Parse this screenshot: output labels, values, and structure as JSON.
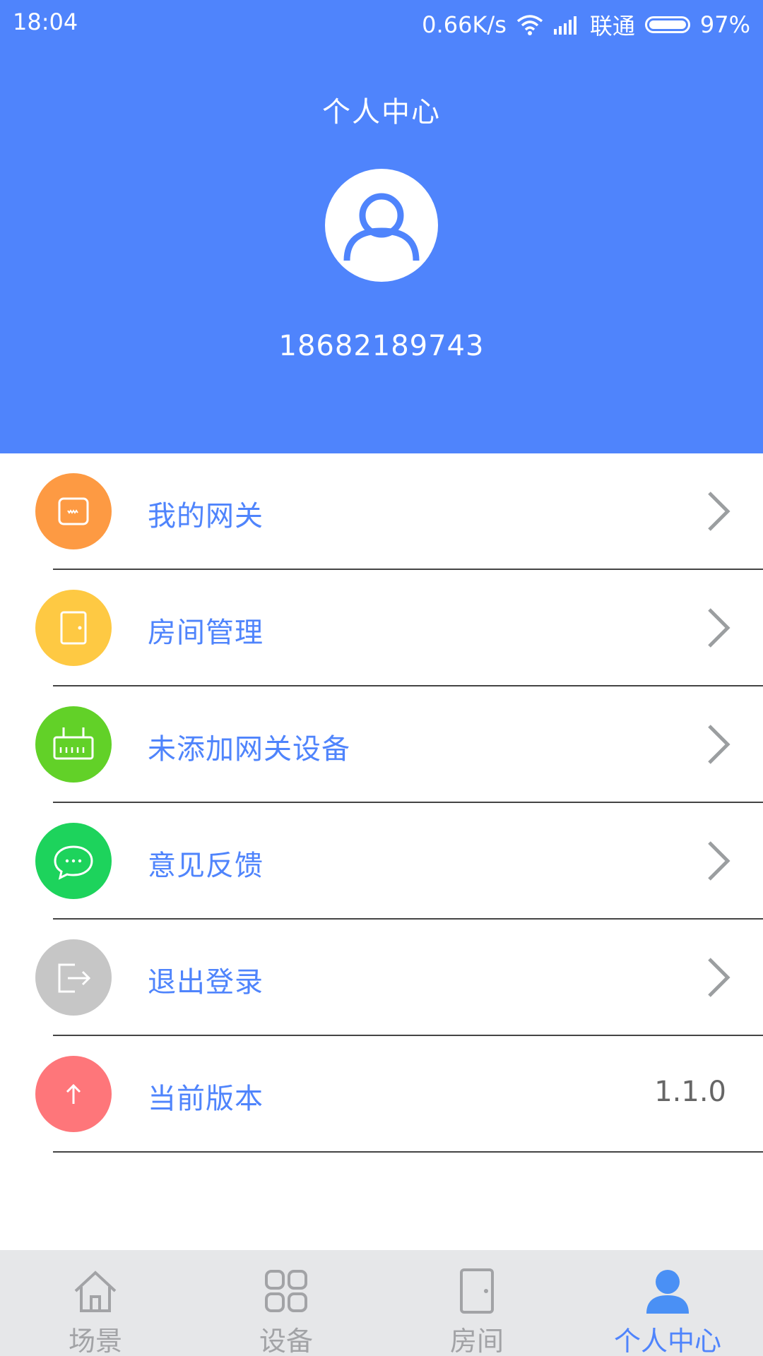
{
  "status_bar": {
    "time": "18:04",
    "network_speed": "0.66K/s",
    "carrier": "联通",
    "battery": "97%"
  },
  "header": {
    "title": "个人中心",
    "phone": "18682189743",
    "avatar_icon": "user-icon"
  },
  "menu": {
    "items": [
      {
        "label": "我的网关",
        "icon": "gateway-icon",
        "color": "#fd9a43"
      },
      {
        "label": "房间管理",
        "icon": "door-icon",
        "color": "#fec943"
      },
      {
        "label": "未添加网关设备",
        "icon": "router-icon",
        "color": "#62d128"
      },
      {
        "label": "意见反馈",
        "icon": "chat-icon",
        "color": "#1dd35c"
      },
      {
        "label": "退出登录",
        "icon": "logout-icon",
        "color": "#c6c6c6"
      },
      {
        "label": "当前版本",
        "icon": "upgrade-icon",
        "color": "#fe767a",
        "value": "1.1.0"
      }
    ]
  },
  "tabbar": {
    "tabs": [
      {
        "label": "场景",
        "icon": "home-icon",
        "active": false
      },
      {
        "label": "设备",
        "icon": "grid-icon",
        "active": false
      },
      {
        "label": "房间",
        "icon": "door-icon",
        "active": false
      },
      {
        "label": "个人中心",
        "icon": "user-icon",
        "active": true
      }
    ]
  },
  "colors": {
    "primary": "#4f84fc",
    "tab_inactive": "#a2a3a6",
    "tabbar_bg": "#e6e7e9"
  }
}
